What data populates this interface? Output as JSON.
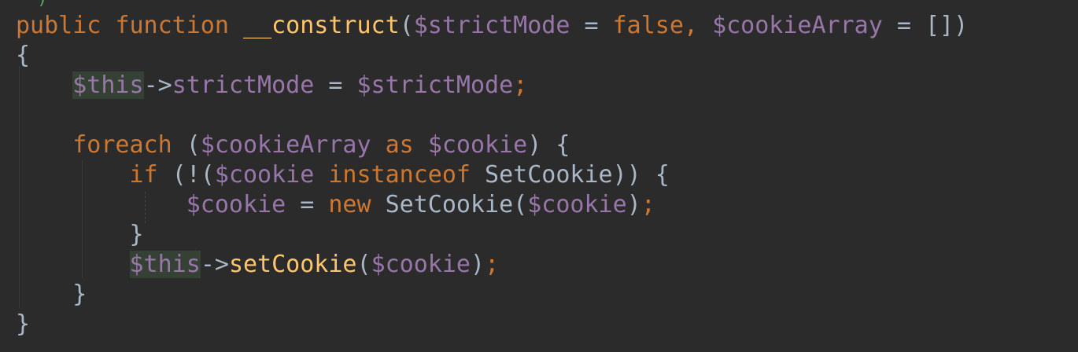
{
  "editor": {
    "colors": {
      "background": "#2b2b2b",
      "keyword": "#cc7832",
      "function_name": "#ffc66d",
      "variable": "#9876aa",
      "text": "#a9b7c6",
      "this_highlight": "#344134"
    },
    "lines": [
      {
        "tokens": [
          {
            "text": "public",
            "kind": "kw"
          },
          {
            "text": " ",
            "kind": "plain"
          },
          {
            "text": "function",
            "kind": "kw"
          },
          {
            "text": " ",
            "kind": "plain"
          },
          {
            "text": "__construct",
            "kind": "fn"
          },
          {
            "text": "(",
            "kind": "plain"
          },
          {
            "text": "$strictMode",
            "kind": "var"
          },
          {
            "text": " = ",
            "kind": "plain"
          },
          {
            "text": "false",
            "kind": "kw"
          },
          {
            "text": ", ",
            "kind": "kw"
          },
          {
            "text": "$cookieArray",
            "kind": "var"
          },
          {
            "text": " = [])",
            "kind": "plain"
          }
        ]
      },
      {
        "tokens": [
          {
            "text": "{",
            "kind": "plain"
          }
        ]
      },
      {
        "tokens": [
          {
            "text": "    ",
            "kind": "plain"
          },
          {
            "text": "$this",
            "kind": "thisbox"
          },
          {
            "text": "->",
            "kind": "plain"
          },
          {
            "text": "strictMode",
            "kind": "var"
          },
          {
            "text": " = ",
            "kind": "plain"
          },
          {
            "text": "$strictMode",
            "kind": "var"
          },
          {
            "text": ";",
            "kind": "semi"
          }
        ]
      },
      {
        "tokens": []
      },
      {
        "tokens": [
          {
            "text": "    ",
            "kind": "plain"
          },
          {
            "text": "foreach",
            "kind": "kw"
          },
          {
            "text": " (",
            "kind": "plain"
          },
          {
            "text": "$cookieArray",
            "kind": "var"
          },
          {
            "text": " ",
            "kind": "plain"
          },
          {
            "text": "as",
            "kind": "kw"
          },
          {
            "text": " ",
            "kind": "plain"
          },
          {
            "text": "$cookie",
            "kind": "var"
          },
          {
            "text": ") {",
            "kind": "plain"
          }
        ]
      },
      {
        "tokens": [
          {
            "text": "        ",
            "kind": "plain"
          },
          {
            "text": "if",
            "kind": "kw"
          },
          {
            "text": " (!(",
            "kind": "plain"
          },
          {
            "text": "$cookie",
            "kind": "var"
          },
          {
            "text": " ",
            "kind": "plain"
          },
          {
            "text": "instanceof",
            "kind": "kw"
          },
          {
            "text": " SetCookie)) {",
            "kind": "plain"
          }
        ]
      },
      {
        "tokens": [
          {
            "text": "            ",
            "kind": "plain"
          },
          {
            "text": "$cookie",
            "kind": "var"
          },
          {
            "text": " = ",
            "kind": "plain"
          },
          {
            "text": "new",
            "kind": "kw"
          },
          {
            "text": " SetCookie(",
            "kind": "plain"
          },
          {
            "text": "$cookie",
            "kind": "var"
          },
          {
            "text": ")",
            "kind": "plain"
          },
          {
            "text": ";",
            "kind": "semi"
          }
        ]
      },
      {
        "tokens": [
          {
            "text": "        }",
            "kind": "plain"
          }
        ]
      },
      {
        "tokens": [
          {
            "text": "        ",
            "kind": "plain"
          },
          {
            "text": "$this",
            "kind": "thisbox"
          },
          {
            "text": "->",
            "kind": "plain"
          },
          {
            "text": "setCookie",
            "kind": "fn"
          },
          {
            "text": "(",
            "kind": "plain"
          },
          {
            "text": "$cookie",
            "kind": "var"
          },
          {
            "text": ")",
            "kind": "plain"
          },
          {
            "text": ";",
            "kind": "semi"
          }
        ]
      },
      {
        "tokens": [
          {
            "text": "    }",
            "kind": "plain"
          }
        ]
      },
      {
        "tokens": [
          {
            "text": "}",
            "kind": "plain"
          }
        ]
      }
    ]
  }
}
